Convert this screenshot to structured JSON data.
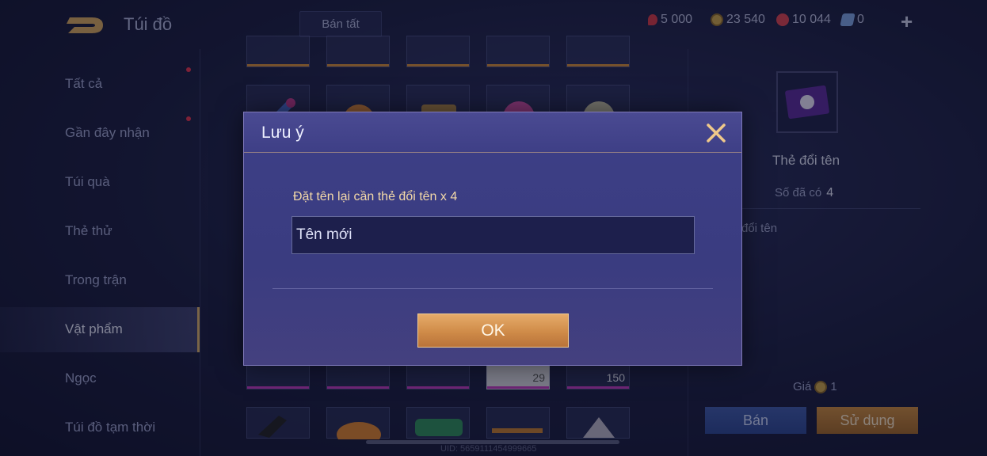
{
  "header": {
    "title": "Túi đồ",
    "sell_all_label": "Bán tất",
    "currencies": [
      {
        "icon": "red-gem-icon",
        "value": "5 000",
        "color": "#d23a46"
      },
      {
        "icon": "gold-coin-icon",
        "value": "23 540",
        "color": "#c9a24a"
      },
      {
        "icon": "ruby-icon",
        "value": "10 044",
        "color": "#d8434f"
      },
      {
        "icon": "voucher-icon",
        "value": "0",
        "color": "#7da3e0"
      }
    ],
    "add_label": "+"
  },
  "sidebar": {
    "items": [
      {
        "label": "Tất cả",
        "notify": true
      },
      {
        "label": "Gần đây nhận",
        "notify": true
      },
      {
        "label": "Túi quà",
        "notify": false
      },
      {
        "label": "Thẻ thử",
        "notify": false
      },
      {
        "label": "Trong trận",
        "notify": false
      },
      {
        "label": "Vật phẩm",
        "notify": false,
        "active": true
      },
      {
        "label": "Ngọc",
        "notify": false
      },
      {
        "label": "Túi đồ tạm thời",
        "notify": false
      }
    ]
  },
  "grid": {
    "counts": [
      "29",
      "150"
    ]
  },
  "detail": {
    "item_name": "Thẻ đổi tên",
    "owned_label": "Số đã có",
    "owned_value": "4",
    "description_visible": "đổi tên",
    "price_label": "Giá",
    "price_value": "1",
    "sell_label": "Bán",
    "use_label": "Sử dụng"
  },
  "footer": {
    "uid": "UID: 5659111454999665"
  },
  "modal": {
    "title": "Lưu ý",
    "message": "Đặt tên lại cần thẻ đổi tên x 4",
    "input_placeholder": "Tên mới",
    "ok_label": "OK"
  }
}
